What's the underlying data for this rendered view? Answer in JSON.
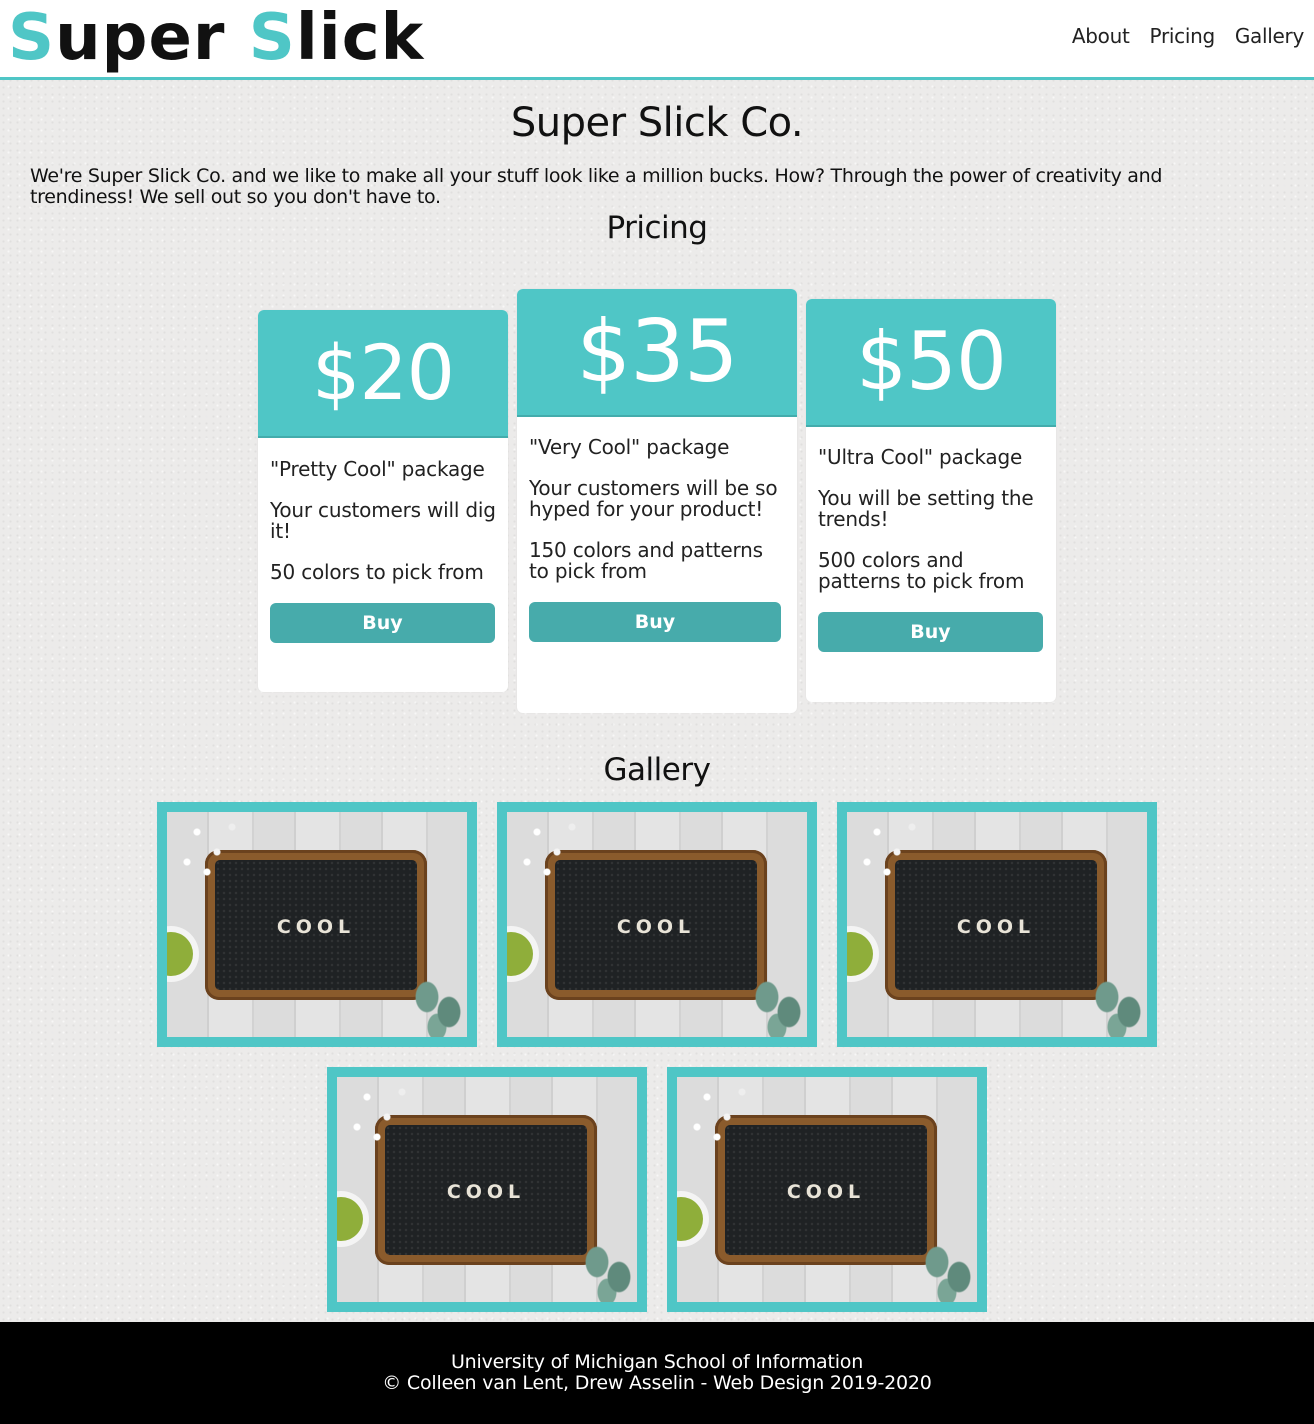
{
  "header": {
    "logo_part1": "S",
    "logo_part2": "uper ",
    "logo_part3": "S",
    "logo_part4": "lick",
    "nav": [
      "About",
      "Pricing",
      "Gallery"
    ]
  },
  "main": {
    "title": "Super Slick Co.",
    "intro": "We're Super Slick Co. and we like to make all your stuff look like a million bucks. How? Through the power of creativity and trendiness! We sell out so you don't have to."
  },
  "pricing": {
    "heading": "Pricing",
    "cards": [
      {
        "price": "$20",
        "package": "\"Pretty Cool\" package",
        "desc": "Your customers will dig it!",
        "options": "50 colors to pick from",
        "button": "Buy"
      },
      {
        "price": "$35",
        "package": "\"Very Cool\" package",
        "desc": "Your customers will be so hyped for your product!",
        "options": "150 colors and patterns to pick from",
        "button": "Buy"
      },
      {
        "price": "$50",
        "package": "\"Ultra Cool\" package",
        "desc": "You will be setting the trends!",
        "options": "500 colors and patterns to pick from",
        "button": "Buy"
      }
    ]
  },
  "gallery": {
    "heading": "Gallery",
    "image_text": "COOL",
    "count": 5
  },
  "footer": {
    "line1": "University of Michigan School of Information",
    "line2": "© Colleen van Lent, Drew Asselin - Web Design 2019-2020"
  },
  "colors": {
    "accent": "#4fc6c6",
    "button": "#47abab",
    "footer_bg": "#000000"
  }
}
